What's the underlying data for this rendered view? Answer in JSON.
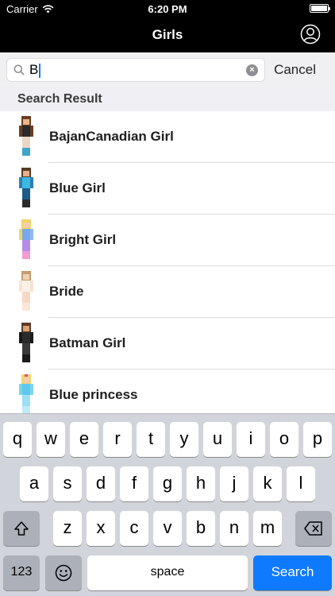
{
  "status_bar": {
    "carrier": "Carrier",
    "time": "6:20 PM"
  },
  "nav": {
    "title": "Girls"
  },
  "search": {
    "value": "B",
    "cancel_label": "Cancel"
  },
  "section": {
    "title": "Search Result"
  },
  "results": [
    {
      "label": "BajanCanadian Girl"
    },
    {
      "label": "Blue Girl"
    },
    {
      "label": "Bright Girl"
    },
    {
      "label": "Bride"
    },
    {
      "label": "Batman Girl"
    },
    {
      "label": "Blue princess"
    }
  ],
  "keyboard": {
    "row1": [
      "q",
      "w",
      "e",
      "r",
      "t",
      "y",
      "u",
      "i",
      "o",
      "p"
    ],
    "row2": [
      "a",
      "s",
      "d",
      "f",
      "g",
      "h",
      "j",
      "k",
      "l"
    ],
    "row3": [
      "z",
      "x",
      "c",
      "v",
      "b",
      "n",
      "m"
    ],
    "numbers_label": "123",
    "space_label": "space",
    "search_label": "Search"
  },
  "colors": {
    "accent": "#0f7afe",
    "nav_bg": "#000000",
    "keyboard_bg": "#d1d5db"
  }
}
